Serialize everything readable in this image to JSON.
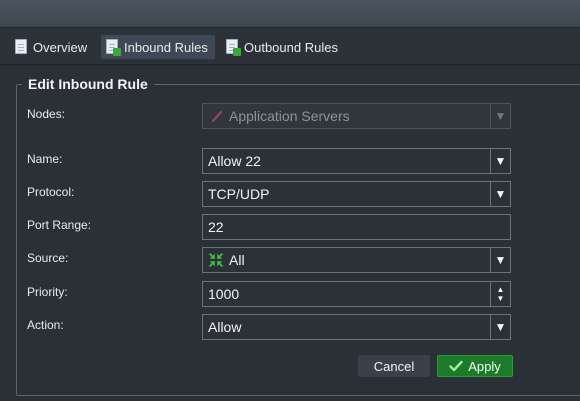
{
  "tabs": [
    {
      "label": "Overview",
      "active": false
    },
    {
      "label": "Inbound Rules",
      "active": true
    },
    {
      "label": "Outbound Rules",
      "active": false
    }
  ],
  "form": {
    "title": "Edit Inbound Rule",
    "nodes": {
      "label": "Nodes:",
      "value": "Application Servers",
      "disabled": true
    },
    "name": {
      "label": "Name:",
      "value": "Allow 22"
    },
    "protocol": {
      "label": "Protocol:",
      "value": "TCP/UDP"
    },
    "port_range": {
      "label": "Port Range:",
      "value": "22"
    },
    "source": {
      "label": "Source:",
      "value": "All"
    },
    "priority": {
      "label": "Priority:",
      "value": "1000"
    },
    "action": {
      "label": "Action:",
      "value": "Allow"
    }
  },
  "buttons": {
    "cancel": "Cancel",
    "apply": "Apply"
  },
  "colors": {
    "accent_green": "#1e7a2b",
    "active_tab": "#3e4955",
    "background": "#2b3036"
  },
  "icons": {
    "tab": "document-icon",
    "nodes": "pencil-icon",
    "source": "nodes-icon",
    "apply": "check-icon"
  }
}
